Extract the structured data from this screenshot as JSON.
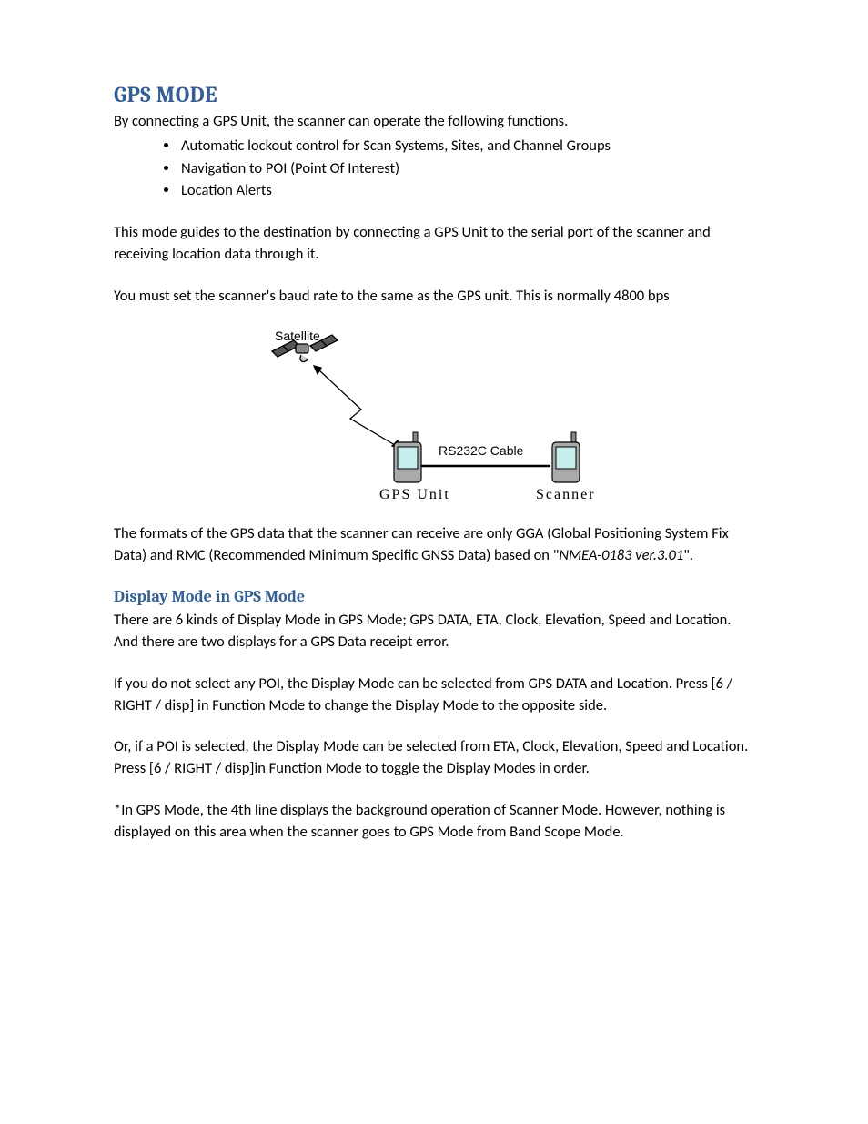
{
  "heading": "GPS MODE",
  "intro": "By connecting a GPS Unit, the scanner can operate the following functions.",
  "bullets": [
    "Automatic lockout control for Scan Systems, Sites, and Channel Groups",
    "Navigation to POI (Point Of Interest)",
    "Location Alerts"
  ],
  "para2": "This mode guides to the destination by connecting a GPS Unit to the serial port of the scanner and receiving location data through it.",
  "para3": "You must set the scanner's baud rate to the same as the GPS unit. This is normally 4800 bps",
  "diagram": {
    "satellite": "Satellite",
    "gps_unit": "GPS Unit",
    "cable": "RS232C Cable",
    "scanner": "Scanner"
  },
  "para4_pre": "The formats of the GPS data that the scanner can receive are only GGA (Global Positioning System Fix Data) and RMC (Recommended Minimum Specific GNSS Data) based on \"",
  "para4_italic": "NMEA-0183 ver.3.01",
  "para4_post": "\".",
  "subheading": "Display Mode in GPS Mode",
  "para5": "There are 6 kinds of Display Mode in GPS Mode; GPS DATA, ETA, Clock, Elevation, Speed and Location. And there are two displays for a GPS Data receipt error.",
  "para6": "If you do not select any POI, the Display Mode can be selected from GPS DATA and Location. Press [6 / RIGHT / disp] in Function Mode to change the Display Mode to the opposite side.",
  "para7": "Or, if a POI is selected, the Display Mode can be selected from ETA, Clock, Elevation, Speed and Location. Press [6 / RIGHT / disp]in Function Mode to toggle the Display Modes in order.",
  "para8": "*In GPS Mode, the 4th line displays the background operation of Scanner Mode. However, nothing is displayed on this area when the scanner goes to GPS Mode from Band Scope Mode."
}
